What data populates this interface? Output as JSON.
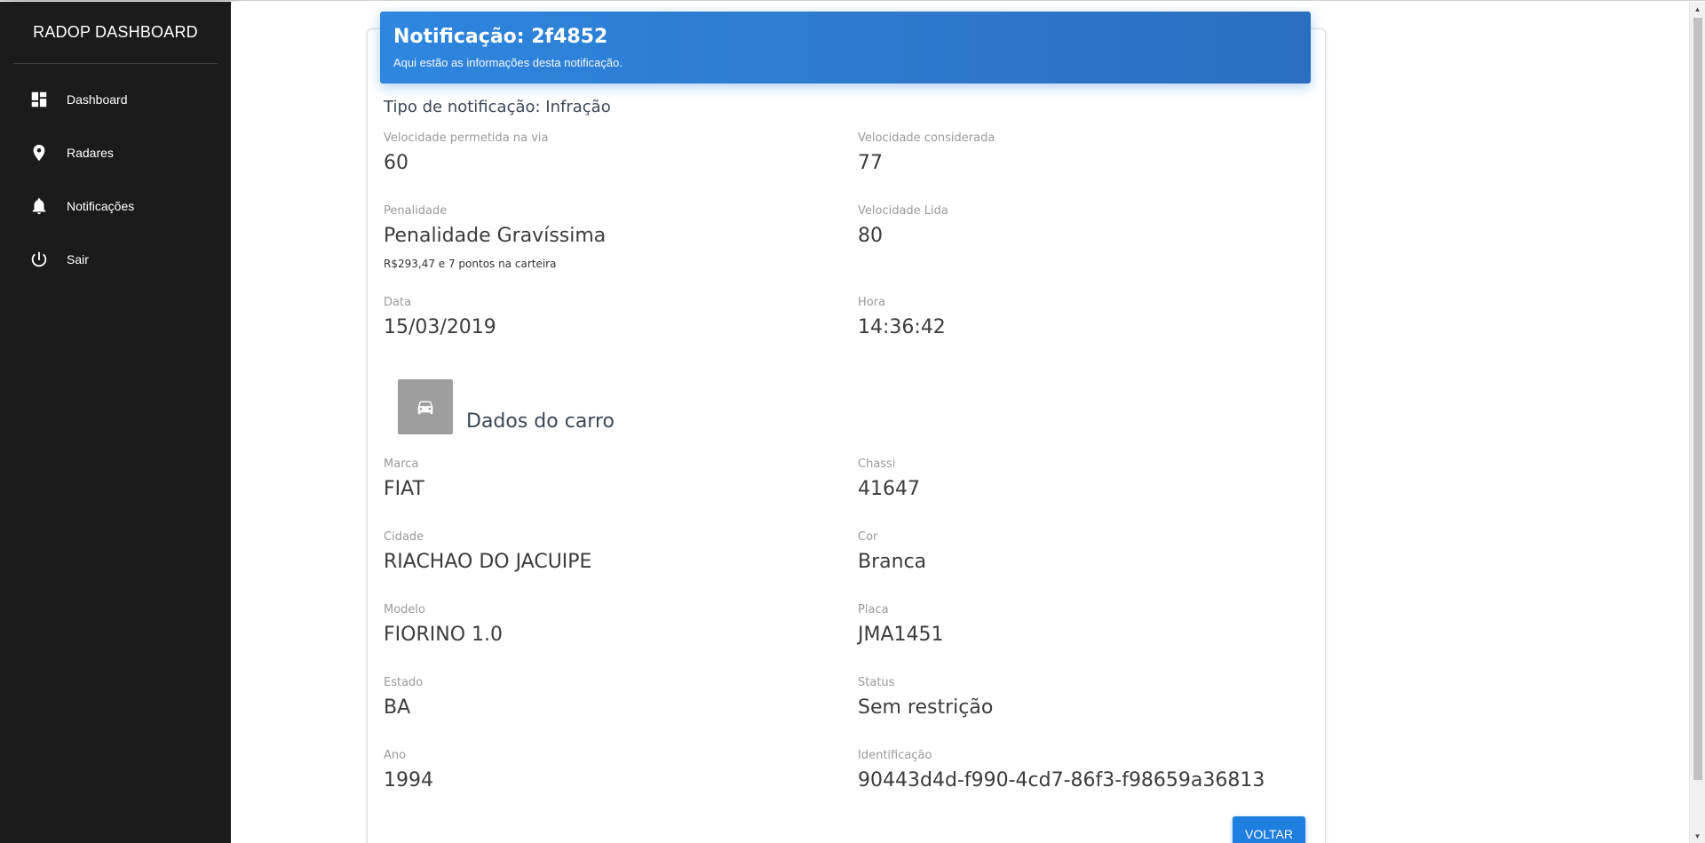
{
  "sidebar": {
    "brand": "RADOP DASHBOARD",
    "items": [
      {
        "label": "Dashboard",
        "icon": "dashboard-icon"
      },
      {
        "label": "Radares",
        "icon": "location-pin-icon"
      },
      {
        "label": "Notificações",
        "icon": "bell-icon"
      },
      {
        "label": "Sair",
        "icon": "power-icon"
      }
    ]
  },
  "header": {
    "title": "Notificação: 2f4852",
    "subtitle": "Aqui estão as informações desta notificação."
  },
  "notification": {
    "type_line": "Tipo de notificação: Infração",
    "speed_allowed_label": "Velocidade permetida na via",
    "speed_allowed_value": "60",
    "speed_considered_label": "Velocidade considerada",
    "speed_considered_value": "77",
    "penalty_label": "Penalidade",
    "penalty_value": "Penalidade Gravíssima",
    "penalty_note": "R$293,47 e 7 pontos na carteira",
    "speed_read_label": "Velocidade Lida",
    "speed_read_value": "80",
    "date_label": "Data",
    "date_value": "15/03/2019",
    "time_label": "Hora",
    "time_value": "14:36:42"
  },
  "car": {
    "section_title": "Dados do carro",
    "icon": "car-icon",
    "brand_label": "Marca",
    "brand_value": "FIAT",
    "chassis_label": "Chassi",
    "chassis_value": "41647",
    "city_label": "Cidade",
    "city_value": "RIACHAO DO JACUIPE",
    "color_label": "Cor",
    "color_value": "Branca",
    "model_label": "Modelo",
    "model_value": "FIORINO 1.0",
    "plate_label": "Placa",
    "plate_value": "JMA1451",
    "state_label": "Estado",
    "state_value": "BA",
    "status_label": "Status",
    "status_value": "Sem restrição",
    "year_label": "Ano",
    "year_value": "1994",
    "id_label": "Identificação",
    "id_value": "90443d4d-f990-4cd7-86f3-f98659a36813"
  },
  "actions": {
    "back_label": "VOLTAR"
  },
  "colors": {
    "sidebar_bg": "#1b1b1b",
    "header_gradient_start": "#2e86de",
    "header_gradient_end": "#2a6fbf",
    "button_bg": "#1e7fe0"
  }
}
